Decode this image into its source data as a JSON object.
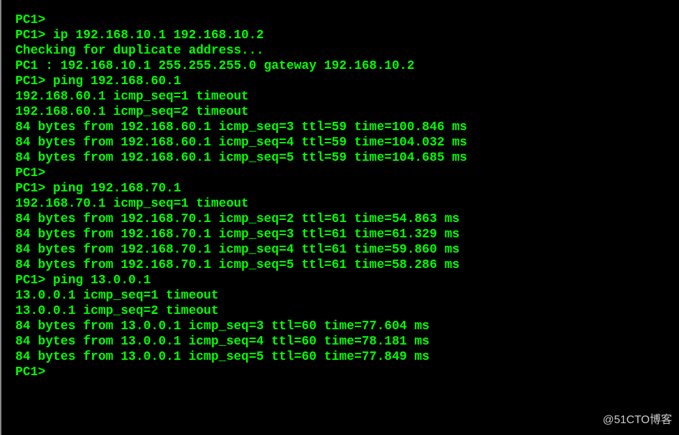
{
  "terminal": {
    "lines": [
      "PC1>",
      "PC1> ip 192.168.10.1 192.168.10.2",
      "Checking for duplicate address...",
      "PC1 : 192.168.10.1 255.255.255.0 gateway 192.168.10.2",
      "",
      "PC1> ping 192.168.60.1",
      "192.168.60.1 icmp_seq=1 timeout",
      "192.168.60.1 icmp_seq=2 timeout",
      "84 bytes from 192.168.60.1 icmp_seq=3 ttl=59 time=100.846 ms",
      "84 bytes from 192.168.60.1 icmp_seq=4 ttl=59 time=104.032 ms",
      "84 bytes from 192.168.60.1 icmp_seq=5 ttl=59 time=104.685 ms",
      "",
      "PC1>",
      "PC1> ping 192.168.70.1",
      "192.168.70.1 icmp_seq=1 timeout",
      "84 bytes from 192.168.70.1 icmp_seq=2 ttl=61 time=54.863 ms",
      "84 bytes from 192.168.70.1 icmp_seq=3 ttl=61 time=61.329 ms",
      "84 bytes from 192.168.70.1 icmp_seq=4 ttl=61 time=59.860 ms",
      "84 bytes from 192.168.70.1 icmp_seq=5 ttl=61 time=58.286 ms",
      "",
      "PC1> ping 13.0.0.1",
      "13.0.0.1 icmp_seq=1 timeout",
      "13.0.0.1 icmp_seq=2 timeout",
      "84 bytes from 13.0.0.1 icmp_seq=3 ttl=60 time=77.604 ms",
      "84 bytes from 13.0.0.1 icmp_seq=4 ttl=60 time=78.181 ms",
      "84 bytes from 13.0.0.1 icmp_seq=5 ttl=60 time=77.849 ms",
      "",
      "PC1>"
    ]
  },
  "watermark": "@51CTO博客"
}
